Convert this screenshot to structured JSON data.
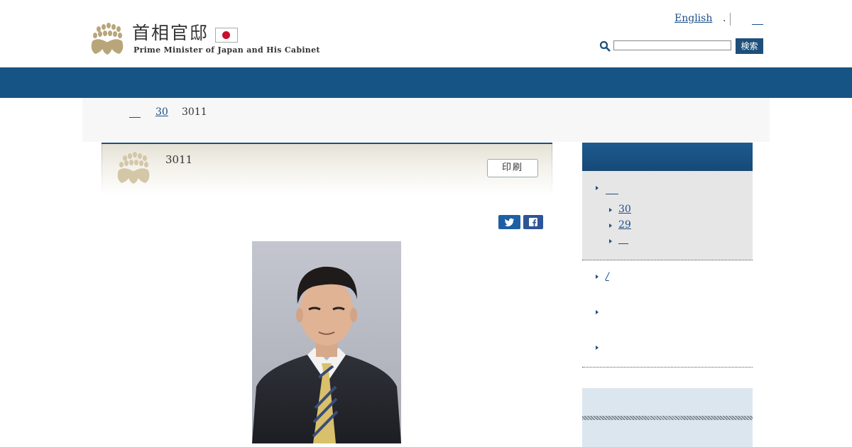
{
  "header": {
    "logo_title": "首相官邸",
    "logo_subtitle": "Prime Minister of Japan and His Cabinet",
    "english_link": "English",
    "dot_link": ".",
    "search_button": "検索",
    "search_placeholder": ""
  },
  "breadcrumb": {
    "year_link": "30",
    "current": "3011"
  },
  "article": {
    "title": "3011",
    "print_button": "印刷"
  },
  "sidebar": {
    "sub_items": [
      "30",
      "29"
    ],
    "row_links": [
      "/"
    ]
  },
  "icons": {
    "emblem": "paulownia-emblem-icon",
    "search": "search-icon",
    "twitter": "twitter-icon",
    "facebook": "facebook-icon",
    "bullet": "triangle-bullet-icon"
  },
  "colors": {
    "navbar": "#165485",
    "link": "#1a4f86",
    "search_button": "#1d4f7a",
    "emblem": "#b8a57a",
    "twitter": "#1f5fa4",
    "facebook": "#2e5597",
    "flag_red": "#c8102e"
  }
}
